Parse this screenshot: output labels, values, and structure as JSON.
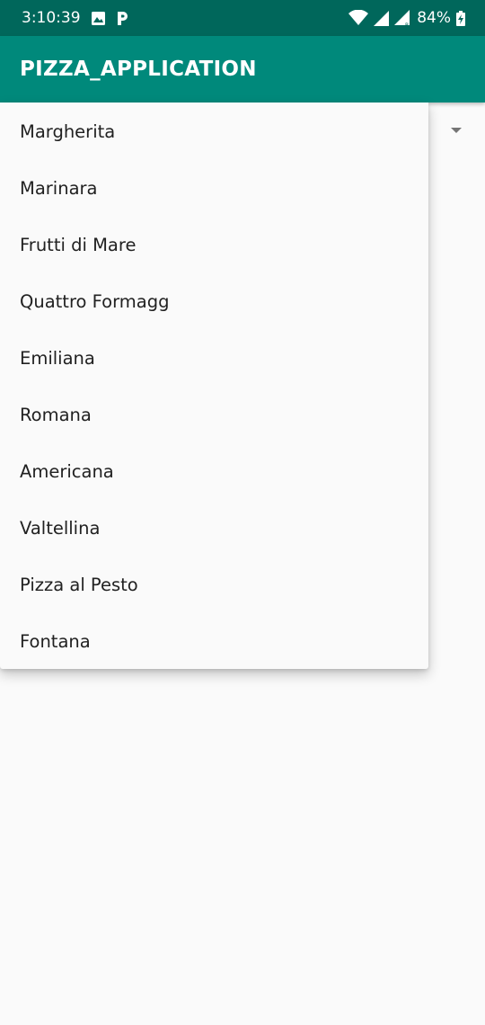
{
  "status_bar": {
    "time": "3:10:39",
    "battery": "84%",
    "icons": [
      "image-icon",
      "parking-icon",
      "wifi-icon",
      "signal-icon",
      "signal-roaming-icon",
      "battery-charging-icon"
    ]
  },
  "app_bar": {
    "title": "PIZZA_APPLICATION",
    "background": "#00897b",
    "status_background": "#00675b"
  },
  "dropdown": {
    "items": [
      {
        "label": "Margherita"
      },
      {
        "label": "Marinara"
      },
      {
        "label": "Frutti di Mare"
      },
      {
        "label": "Quattro Formagg"
      },
      {
        "label": "Emiliana"
      },
      {
        "label": "Romana"
      },
      {
        "label": "Americana"
      },
      {
        "label": "Valtellina"
      },
      {
        "label": "Pizza al Pesto"
      },
      {
        "label": "Fontana"
      }
    ]
  }
}
